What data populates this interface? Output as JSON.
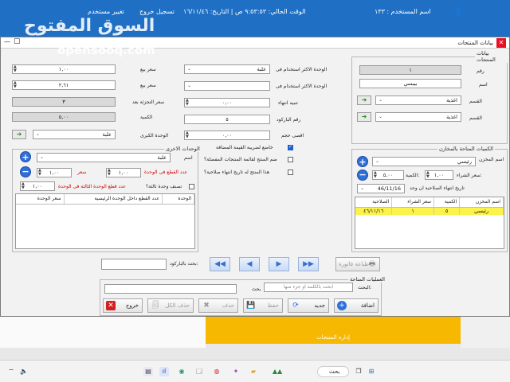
{
  "background": {
    "user_label": "اسم المستخدم : ١٣٣",
    "status": "الوقت الحالي: ٩:٥٣:٥٣ ص | التاريخ: ١٦/١١/٤٦",
    "logout": "تسجيل خروج",
    "change_user": "تغيير مستخدم",
    "watermark_ar": "السوق المفتوح",
    "watermark_en": "opensooq.com",
    "tile_label": "إدارة المنتجات"
  },
  "window": {
    "title": "بيانات المنتجات",
    "close": "✕",
    "minimize": "—",
    "maximize": "▢"
  },
  "product": {
    "group_title": "بيانات المنتجات",
    "number_label": "رقم",
    "number_value": "١",
    "name_label": "اسم",
    "name_value": "بيبسي",
    "section_label": "القسم",
    "section_value": "اغذية",
    "category_label": "القسم",
    "category_value": "اغذية",
    "most_used_unit_label": "الوحدة الاكثر استخدام فى",
    "most_used_unit_value": "علبة",
    "most_used_unit2_label": "الوحدة الاكثر استخدام فى",
    "most_used_unit2_value": "",
    "expiry_alert_label": "تنبيه انتهاء",
    "expiry_alert_value": "٠,٠٠",
    "barcode_label": "رقم الباركود",
    "barcode_value": "٥",
    "max_qty_label": "اقصى حجم",
    "max_qty_value": "٠,٠٠",
    "sell_price_label": "سعر بيع",
    "sell_price_value": "١,٠٠",
    "sell_price2_label": "سعر بيع",
    "sell_price2_value": "٢,٦١",
    "retail_price_label": "سعر التجزئة بعد",
    "retail_price_value": "٣",
    "quantity_label": "الكمية",
    "quantity_value": "٥,٠٠",
    "main_unit_label": "الوحدة الكبرى",
    "main_unit_value": "علبة"
  },
  "checks": {
    "vat": "خاضع لضريبة القيمة المضافة",
    "favorites": "ضم المنتج لقائمة المنتجات المفضلة؟",
    "expiry": "هذا المنتج له تاريخ انتهاء صلاحية؟",
    "third_unit": "تصنف وحدة ثالثة؟"
  },
  "units": {
    "group_title": "الوحدات الاخرى",
    "name_label": "اسم",
    "name_value": "علبة",
    "price_label": "سعر",
    "price_value": "١,٠٠",
    "count_label": "عدد القطع فى الوحدة",
    "count_value": "١,٠٠",
    "third_count_label": "عدد قطع الوحدة الثالثة فى الوحدة",
    "third_count_value": "١,٠٠",
    "table_headers": [
      "الوحدة",
      "عدد القطع داخل الوحدة الرئيسية",
      "سعر الوحدة"
    ]
  },
  "stock": {
    "group_title": "الكميات المتاحة بالمخازن",
    "warehouse_label": "اسم المخزن",
    "warehouse_value": "رئيسي",
    "qty_label": "الكمية:",
    "qty_value": "٥,٠٠",
    "buy_price_label": "سعر الشراء:",
    "buy_price_value": "١,٠٠",
    "expiry_date_label": "تاريخ انتهاء الصلاحية ان وجد",
    "expiry_date_value": "46/11/16",
    "table_headers": [
      "اسم المخزن",
      "الكمية",
      "سعر الشراء",
      "الصلاحية"
    ],
    "rows": [
      {
        "warehouse": "رئيسي",
        "qty": "٥",
        "buy": "١",
        "expiry": "٤٦/١١/١٦"
      }
    ]
  },
  "barcode_search": {
    "label": "بحث بالباركود:",
    "value": "",
    "print_label": "طباعة فاتورة"
  },
  "operations": {
    "group_title": "العمليات المتاحة",
    "search_label": "البحث:",
    "search_placeholder": "ابحث بالكلمة او جزء منها",
    "search_btn": "بحث",
    "search_value": "",
    "add": "اضافة",
    "new": "جديد",
    "save": "حفظ",
    "delete": "حذف",
    "delete_all": "حذف الكل",
    "exit": "خروج"
  },
  "taskbar": {
    "search": "بحث"
  }
}
